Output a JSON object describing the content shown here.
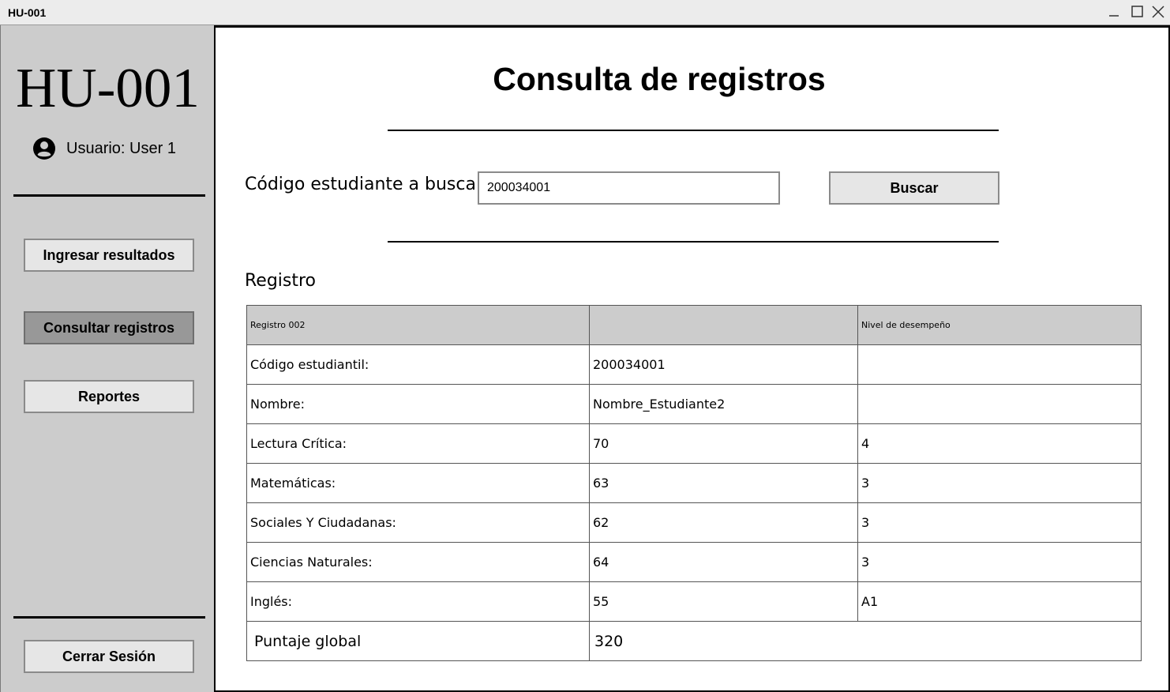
{
  "window": {
    "title": "HU-001",
    "controls": [
      "minimize-icon",
      "maximize-icon",
      "close-icon"
    ]
  },
  "sidebar": {
    "app_title": "HU-001",
    "user_label": "Usuario: User 1",
    "user_icon": "user-circle-icon",
    "nav": [
      {
        "label": "Ingresar resultados",
        "active": false
      },
      {
        "label": "Consultar registros",
        "active": true
      },
      {
        "label": "Reportes",
        "active": false
      }
    ],
    "logout_label": "Cerrar Sesión"
  },
  "main": {
    "title": "Consulta de registros",
    "search": {
      "label": "Código estudiante a buscar",
      "value": "200034001",
      "button_label": "Buscar"
    },
    "section_title": "Registro",
    "table": {
      "header": [
        "Registro 002",
        "",
        "Nivel de desempeño"
      ],
      "rows": [
        [
          "Código estudiantil:",
          "200034001",
          ""
        ],
        [
          "Nombre:",
          "Nombre_Estudiante2",
          ""
        ],
        [
          "Lectura Crítica:",
          "70",
          "4"
        ],
        [
          "Matemáticas:",
          "63",
          "3"
        ],
        [
          "Sociales Y Ciudadanas:",
          "62",
          "3"
        ],
        [
          "Ciencias Naturales:",
          "64",
          "3"
        ],
        [
          "Inglés:",
          "55",
          "A1"
        ]
      ],
      "total_label": "Puntaje global",
      "total_value": "320"
    }
  },
  "colors": {
    "sidebar_bg": "#cccccc",
    "button_bg": "#e6e6e6",
    "active_button_bg": "#989898",
    "table_header_bg": "#cccccc"
  }
}
